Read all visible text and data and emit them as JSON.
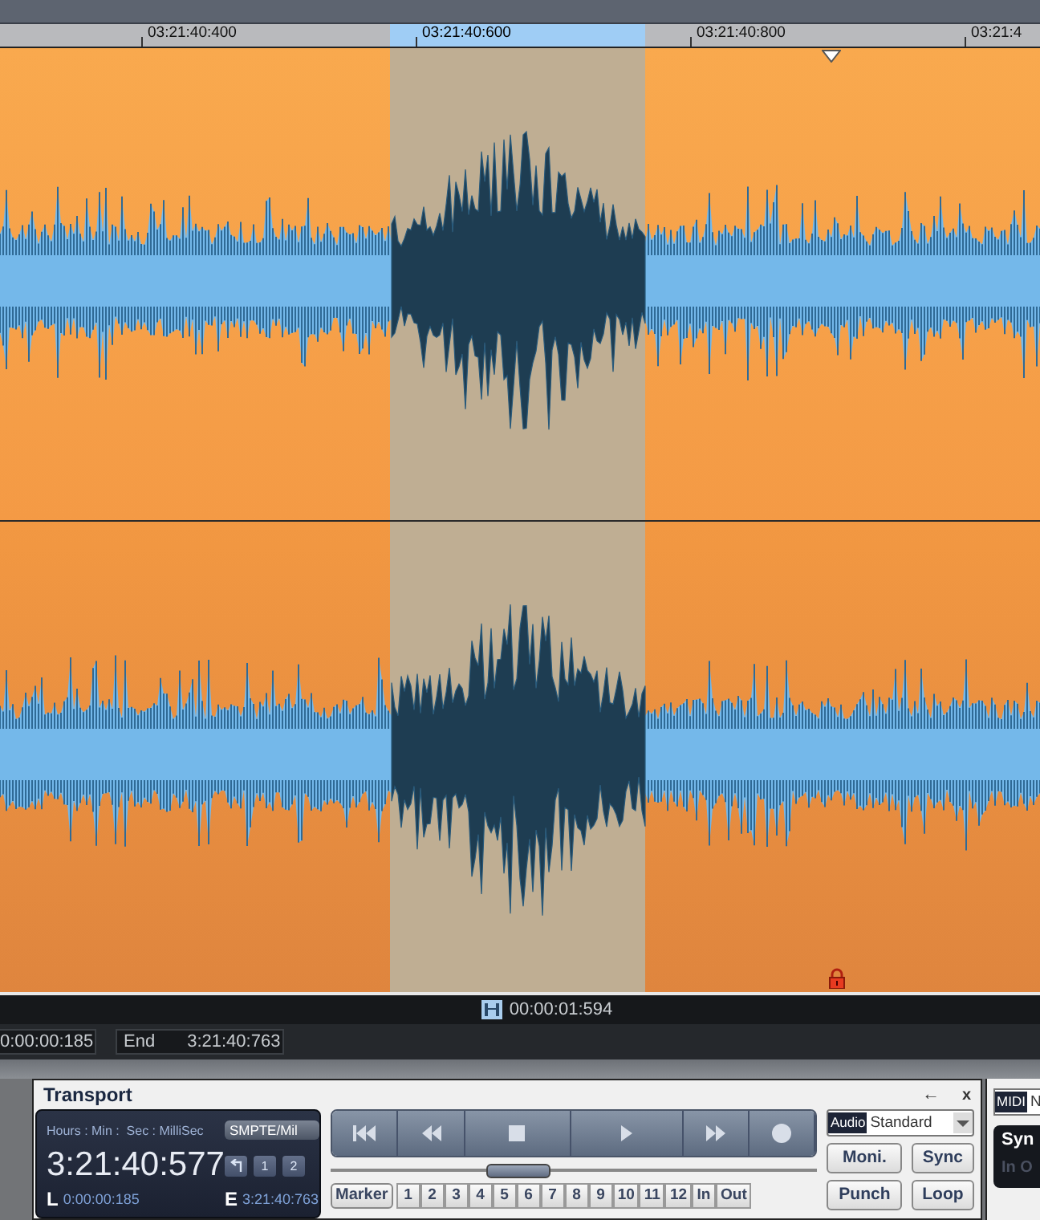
{
  "ruler": {
    "ticks": [
      {
        "label": "03:21:40:400",
        "selected": false
      },
      {
        "label": "03:21:40:600",
        "selected": true
      },
      {
        "label": "03:21:40:800",
        "selected": false
      },
      {
        "label": "03:21:4",
        "selected": false
      }
    ]
  },
  "status": {
    "length": "00:00:01:594",
    "start": "0:00:00:185",
    "end_label": "End",
    "end": "3:21:40:763"
  },
  "transport": {
    "title": "Transport",
    "back": "←",
    "close": "x",
    "format_label": "Hours : Min :  Sec : MilliSec",
    "format": "SMPTE/Mil",
    "time": "3:21:40:577",
    "l_label": "L",
    "l_value": "0:00:00:185",
    "e_label": "E",
    "e_value": "3:21:40:763",
    "mem_buttons": [
      "1",
      "2"
    ],
    "marker_label": "Marker",
    "markers": [
      "1",
      "2",
      "3",
      "4",
      "5",
      "6",
      "7",
      "8",
      "9",
      "10",
      "11",
      "12",
      "In",
      "Out"
    ],
    "audio_tag": "Audio",
    "audio_mode": "Standard",
    "buttons": [
      "Moni.",
      "Sync",
      "Punch",
      "Loop"
    ]
  },
  "side_panel": {
    "midi_tag": "MIDI",
    "midi_value": "N",
    "sync_label": "Syn",
    "inout_label": "In O"
  }
}
